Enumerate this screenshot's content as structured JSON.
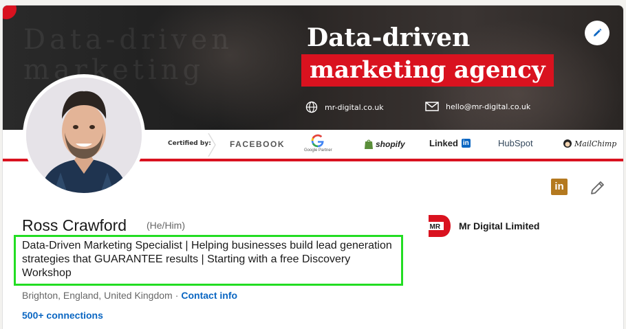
{
  "banner": {
    "ghost_text": "Data-driven marketing",
    "headline_line1": "Data-driven",
    "headline_line2": "marketing agency",
    "website": "mr-digital.co.uk",
    "email": "hello@mr-digital.co.uk",
    "accent_color": "#d9121f"
  },
  "certifications": {
    "label": "Certified by:",
    "items": [
      "FACEBOOK",
      "Google Partner",
      "shopify",
      "Linked",
      "in",
      "HubSpot",
      "MailChimp"
    ]
  },
  "profile": {
    "name": "Ross Crawford",
    "pronouns": "(He/Him)",
    "headline": "Data-Driven Marketing Specialist | Helping businesses build lead generation strategies that GUARANTEE results | Starting with a free Discovery Workshop",
    "location": "Brighton, England, United Kingdom",
    "separator": "·",
    "contact_info": "Contact info",
    "connections": "500+ connections"
  },
  "company": {
    "logo_text": "MR",
    "name": "Mr Digital Limited"
  },
  "icons": {
    "linkedin_badge": "in",
    "edit_banner": "pencil-icon",
    "edit_intro": "pencil-icon"
  }
}
